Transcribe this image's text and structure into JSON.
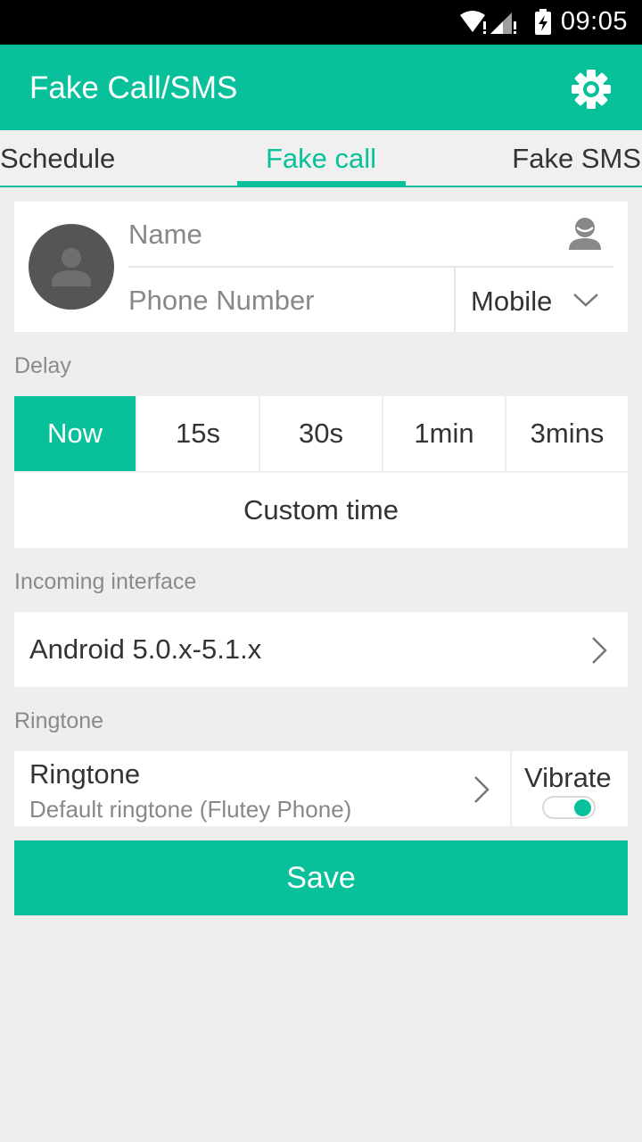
{
  "status_bar": {
    "time": "09:05"
  },
  "app_bar": {
    "title": "Fake Call/SMS",
    "settings_icon": "gear-icon"
  },
  "tabs": [
    {
      "label": "Schedule",
      "selected": false
    },
    {
      "label": "Fake call",
      "selected": true
    },
    {
      "label": "Fake SMS",
      "selected": false
    }
  ],
  "contact": {
    "name_placeholder": "Name",
    "phone_placeholder": "Phone Number",
    "number_type": "Mobile"
  },
  "delay": {
    "label": "Delay",
    "options": [
      "Now",
      "15s",
      "30s",
      "1min",
      "3mins"
    ],
    "selected": "Now",
    "custom_label": "Custom time"
  },
  "incoming_interface": {
    "label": "Incoming interface",
    "value": "Android 5.0.x-5.1.x"
  },
  "ringtone": {
    "section_label": "Ringtone",
    "title": "Ringtone",
    "value": "Default ringtone (Flutey Phone)",
    "vibrate_label": "Vibrate",
    "vibrate_on": true
  },
  "save_label": "Save",
  "colors": {
    "accent": "#08c19a",
    "background": "#eeeeee",
    "status_bar": "#000000"
  }
}
